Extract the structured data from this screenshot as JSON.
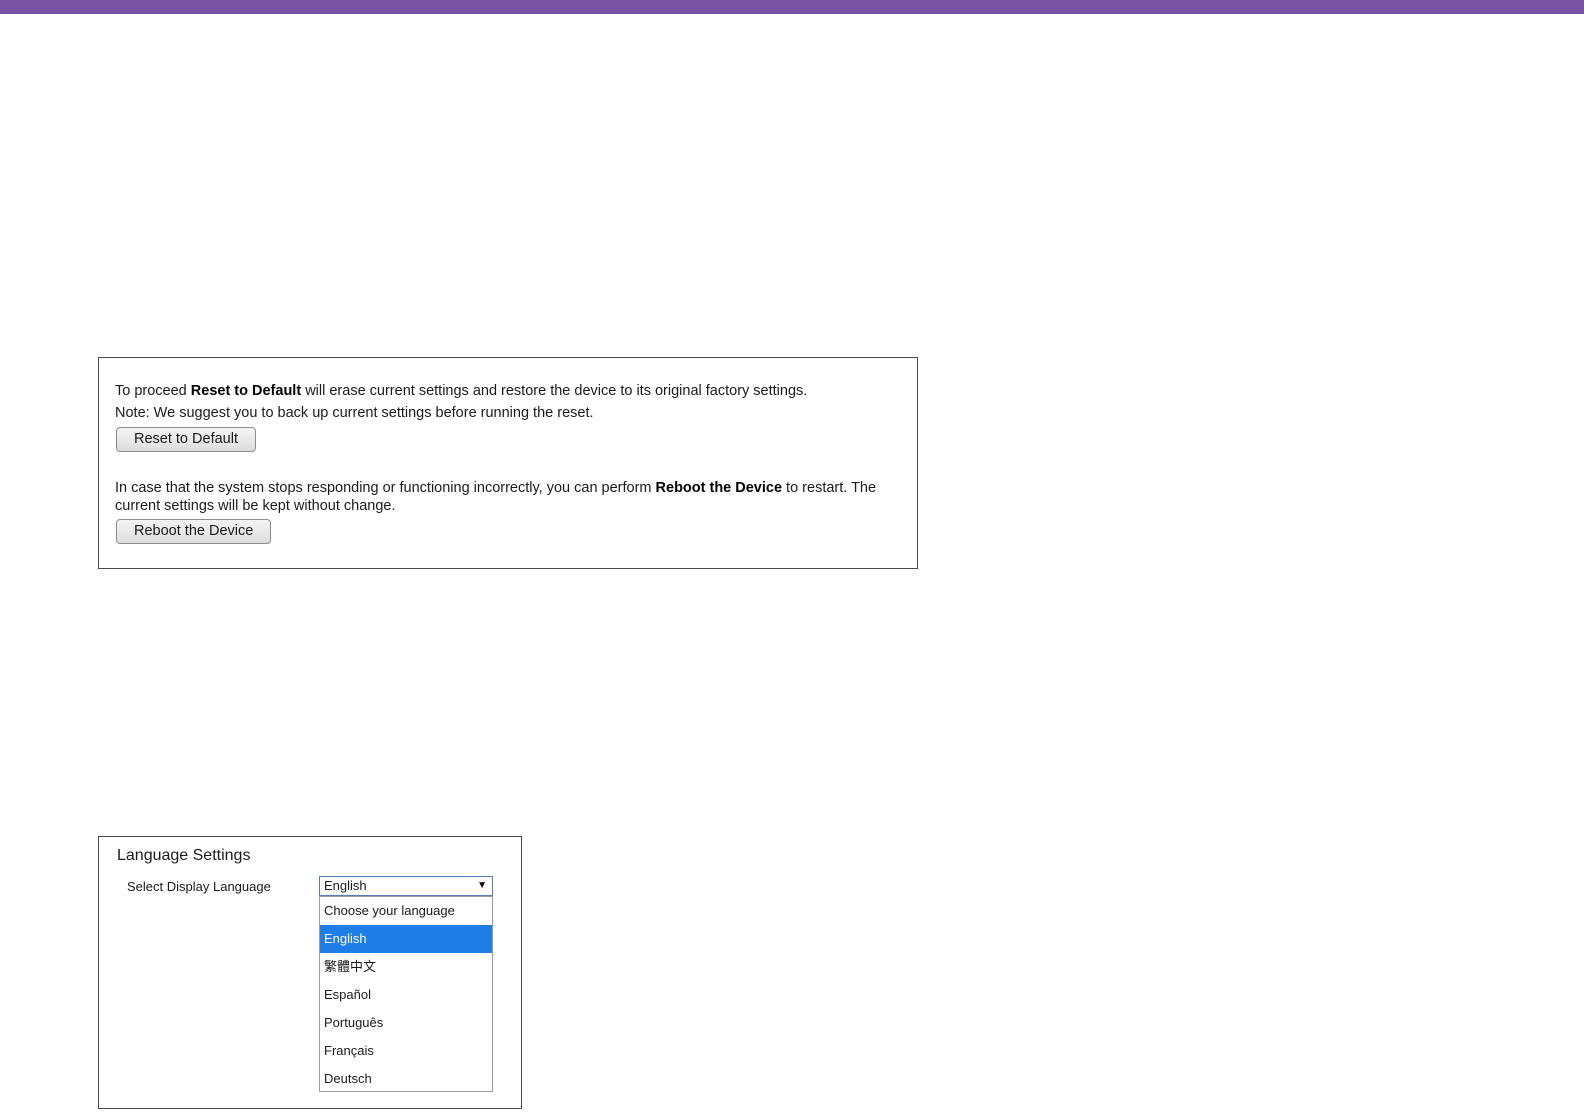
{
  "maintenance": {
    "reset_text_pre": "To proceed ",
    "reset_text_bold": "Reset to Default",
    "reset_text_post": " will erase current settings and restore the device to its original factory settings.",
    "note_text": "Note: We suggest you to back up current settings before running the reset.",
    "reset_button_label": "Reset to Default",
    "reboot_text_pre": "In case that the system stops responding or functioning incorrectly, you can perform ",
    "reboot_text_bold": "Reboot the Device",
    "reboot_text_post": " to restart. The",
    "reboot_text_line2": "current settings will be kept without change.",
    "reboot_button_label": "Reboot the Device"
  },
  "language": {
    "title": "Language Settings",
    "select_label": "Select Display Language",
    "selected_value": "English",
    "options": [
      "Choose your language",
      "English",
      "繁體中文",
      "Español",
      "Português",
      "Français",
      "Deutsch"
    ],
    "highlighted_option": "English",
    "highlight_color": "#1e7de6"
  },
  "colors": {
    "top_bar": "#7a52a4"
  }
}
